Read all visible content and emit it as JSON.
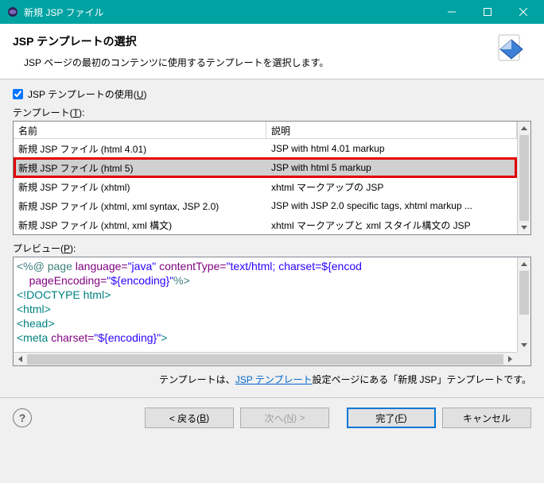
{
  "window": {
    "title": "新規 JSP ファイル"
  },
  "header": {
    "title": "JSP テンプレートの選択",
    "subtitle": "JSP ページの最初のコンテンツに使用するテンプレートを選択します。"
  },
  "checkbox": {
    "label": "JSP テンプレートの使用(",
    "mnemonic": "U",
    "suffix": ")"
  },
  "templates_label": {
    "text": "テンプレート(",
    "mnemonic": "T",
    "suffix": "):"
  },
  "columns": {
    "name": "名前",
    "desc": "説明"
  },
  "rows": [
    {
      "name": "新規 JSP ファイル (html 4.01)",
      "desc": "JSP with html 4.01 markup",
      "selected": false,
      "highlight": false
    },
    {
      "name": "新規 JSP ファイル (html 5)",
      "desc": "JSP with html 5 markup",
      "selected": true,
      "highlight": true
    },
    {
      "name": "新規 JSP ファイル (xhtml)",
      "desc": "xhtml マークアップの JSP",
      "selected": false,
      "highlight": false
    },
    {
      "name": "新規 JSP ファイル (xhtml, xml syntax, JSP 2.0)",
      "desc": "JSP with JSP 2.0 specific tags, xhtml markup ...",
      "selected": false,
      "highlight": false
    },
    {
      "name": "新規 JSP ファイル (xhtml, xml 構文)",
      "desc": "xhtml マークアップと xml スタイル構文の JSP",
      "selected": false,
      "highlight": false
    }
  ],
  "preview_label": {
    "text": "プレビュー(",
    "mnemonic": "P",
    "suffix": "):"
  },
  "preview_code": {
    "l1a": "<%@",
    "l1b": " page ",
    "l1c": "language=",
    "l1d": "\"java\"",
    "l1e": " contentType=",
    "l1f": "\"text/html; charset=${encod",
    "l2a": "pageEncoding=",
    "l2b": "\"${encoding}\"",
    "l2c": "%>",
    "l3": "<!DOCTYPE html>",
    "l4": "<html>",
    "l5": "<head>",
    "l6a": "<meta ",
    "l6b": "charset=",
    "l6c": "\"${encoding}\"",
    "l6d": ">"
  },
  "linkline": {
    "before": "テンプレートは、",
    "link": "JSP テンプレート",
    "after": "設定ページにある「新規 JSP」テンプレートです。"
  },
  "buttons": {
    "back": "< 戻る(",
    "back_m": "B",
    "back_s": ")",
    "next": "次へ(",
    "next_m": "N",
    "next_s": ") >",
    "finish": "完了(",
    "finish_m": "F",
    "finish_s": ")",
    "cancel": "キャンセル"
  }
}
